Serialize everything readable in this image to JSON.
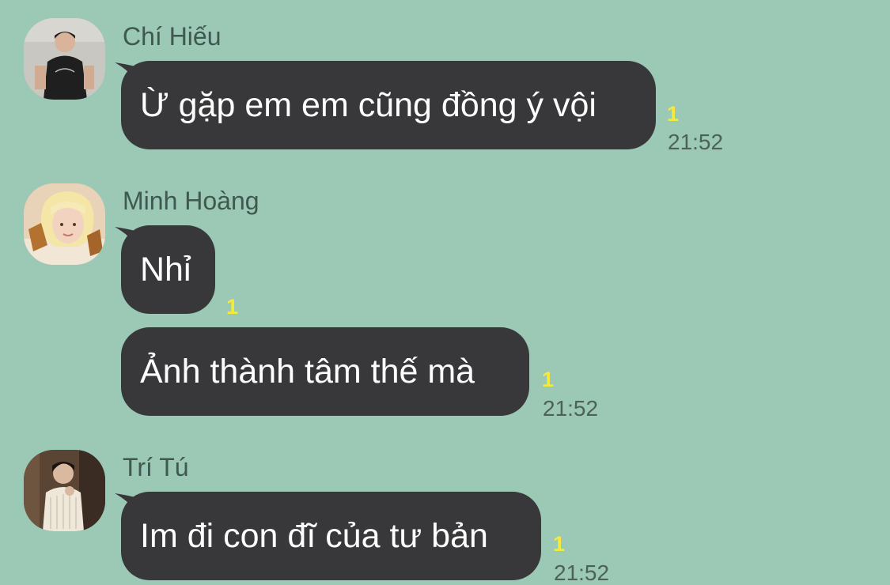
{
  "messages": [
    {
      "sender": "Chí Hiếu",
      "avatar": "avatar-chi-hieu",
      "bubbles": [
        {
          "text": "Ừ gặp em em cũng đồng ý vội",
          "unread": "1",
          "time": "21:52"
        }
      ]
    },
    {
      "sender": "Minh Hoàng",
      "avatar": "avatar-minh-hoang",
      "bubbles": [
        {
          "text": "Nhỉ",
          "unread": "1",
          "time": ""
        },
        {
          "text": "Ảnh thành tâm thế mà",
          "unread": "1",
          "time": "21:52"
        }
      ]
    },
    {
      "sender": "Trí Tú",
      "avatar": "avatar-tri-tu",
      "bubbles": [
        {
          "text": "Im đi con đĩ của tư bản",
          "unread": "1",
          "time": "21:52"
        }
      ]
    }
  ],
  "colors": {
    "background": "#9cc8b6",
    "bubble": "#38383b",
    "unread": "#f5e93b",
    "meta": "#4c6259"
  }
}
